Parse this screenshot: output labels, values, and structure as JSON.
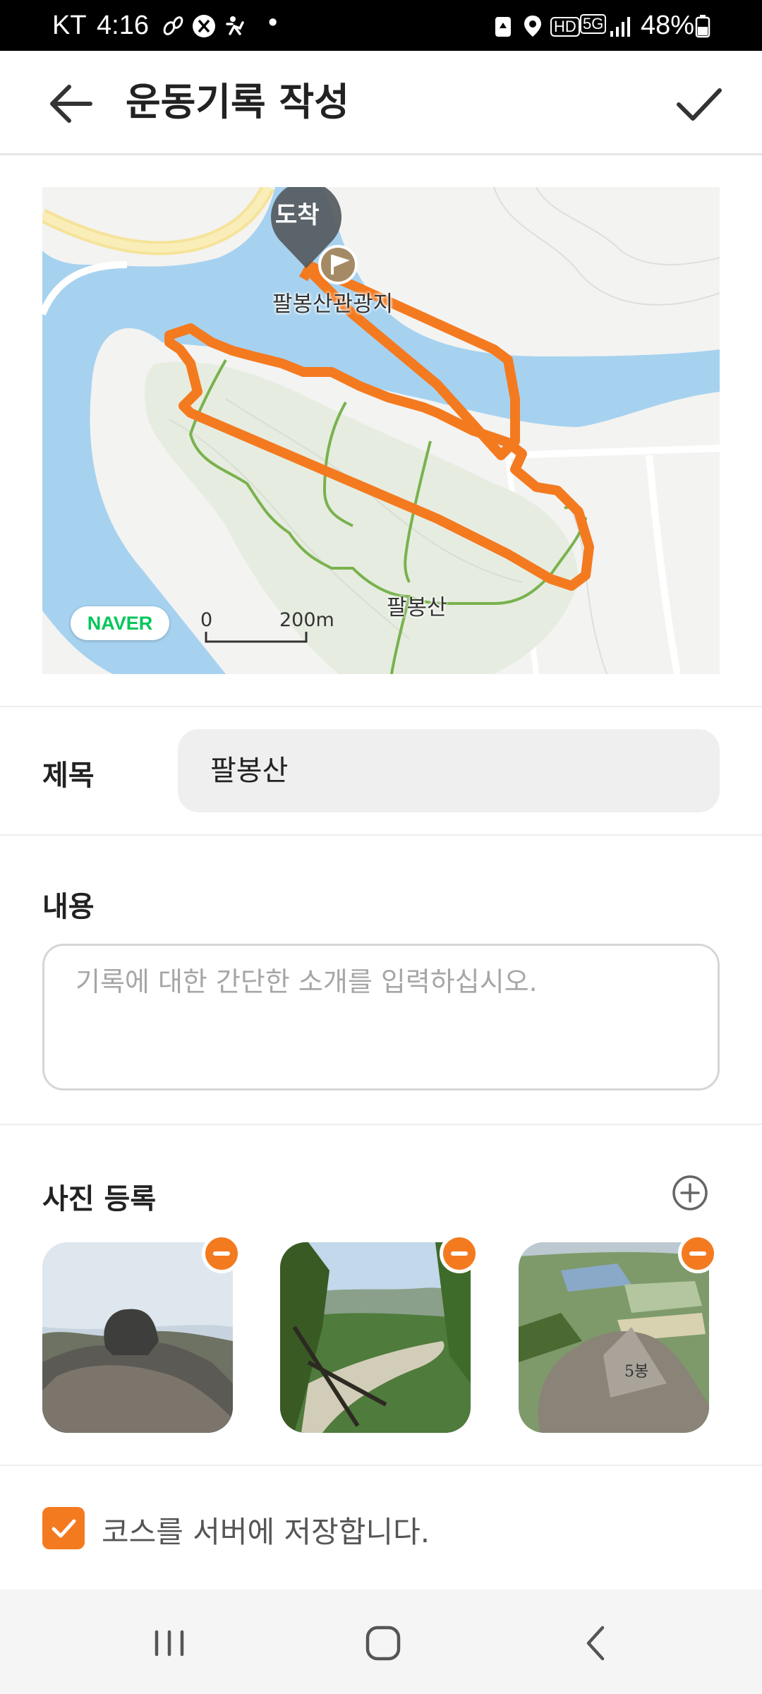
{
  "status_bar": {
    "carrier": "KT",
    "time": "4:16",
    "dot": "•",
    "network_badge": "HD",
    "network_type": "5G",
    "battery": "48%",
    "icons": [
      "steps-icon",
      "x-icon",
      "activity-icon",
      "recycle-icon",
      "location-icon",
      "signal-icon",
      "battery-icon"
    ]
  },
  "app_bar": {
    "title": "운동기록 작성",
    "back_icon": "arrow-left-icon",
    "confirm_icon": "check-icon"
  },
  "map": {
    "marker_label": "도착",
    "poi_label": "팔봉산관광지",
    "peak_label": "팔봉산",
    "provider": "NAVER",
    "scale_start": "0",
    "scale_end": "200m",
    "colors": {
      "water": "#a6d2f0",
      "track": "#f47a20",
      "trail": "#7ab24e",
      "land": "#f3f3f1",
      "park": "#e6ede0"
    }
  },
  "form": {
    "title_label": "제목",
    "title_value": "팔봉산",
    "content_label": "내용",
    "content_placeholder": "기록에 대한 간단한 소개를 입력하십시오.",
    "photos_label": "사진 등록",
    "photos": [
      {
        "alt": "photo-1",
        "remove_icon": "minus-circle-icon"
      },
      {
        "alt": "photo-2",
        "remove_icon": "minus-circle-icon"
      },
      {
        "alt": "photo-3",
        "remove_icon": "minus-circle-icon",
        "carved_text": "5봉"
      }
    ],
    "save_course_label": "코스를 서버에 저장합니다.",
    "save_course_checked": true
  },
  "nav_bar": {
    "items": [
      "recents-icon",
      "home-icon",
      "back-icon"
    ]
  },
  "theme": {
    "accent": "#f47a20",
    "text": "#222222",
    "muted": "#a6a6a6"
  }
}
